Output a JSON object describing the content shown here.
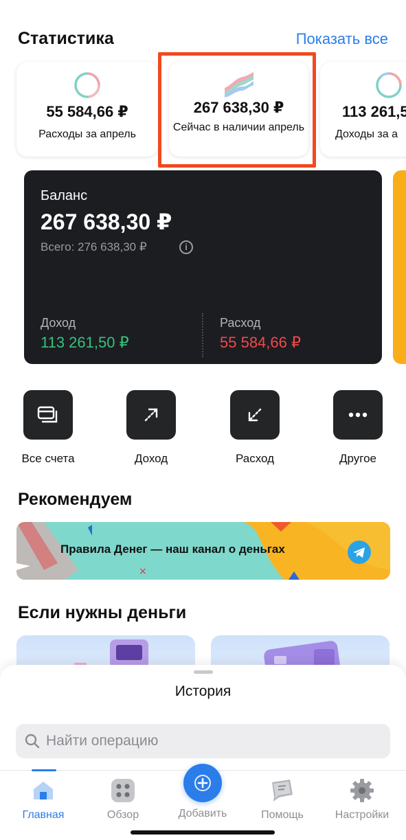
{
  "stats": {
    "title": "Статистика",
    "show_all": "Показать все",
    "cards": [
      {
        "amount": "55 584,66 ₽",
        "label": "Расходы за апрель"
      },
      {
        "amount": "267 638,30 ₽",
        "label": "Сейчас в наличии апрель"
      },
      {
        "amount": "113 261,5",
        "label": "Доходы за а"
      }
    ],
    "highlight_color": "#f2491f"
  },
  "balance": {
    "title": "Баланс",
    "amount": "267 638,30 ₽",
    "total": "Всего: 276 638,30 ₽",
    "info_icon": "i",
    "income_label": "Доход",
    "income_value": "113 261,50 ₽",
    "expense_label": "Расход",
    "expense_value": "55 584,66 ₽",
    "income_color": "#36c27e",
    "expense_color": "#f04a4a"
  },
  "actions": [
    {
      "label": "Все счета",
      "icon": "wallet-cards-icon"
    },
    {
      "label": "Доход",
      "icon": "arrow-up-right-icon"
    },
    {
      "label": "Расход",
      "icon": "arrow-down-left-icon"
    },
    {
      "label": "Другое",
      "icon": "more-dots-icon"
    }
  ],
  "recommend": {
    "title": "Рекомендуем",
    "banner_text": "Правила Денег — наш канал о деньгах",
    "banner_icon": "telegram-icon"
  },
  "money": {
    "title": "Если нужны деньги"
  },
  "history": {
    "title": "История",
    "search_placeholder": "Найти операцию"
  },
  "tabs": [
    {
      "label": "Главная",
      "icon": "home-icon",
      "active": true
    },
    {
      "label": "Обзор",
      "icon": "grid-icon",
      "active": false
    },
    {
      "label": "Добавить",
      "icon": "plus-icon",
      "active": false
    },
    {
      "label": "Помощь",
      "icon": "chat-help-icon",
      "active": false
    },
    {
      "label": "Настройки",
      "icon": "gear-icon",
      "active": false
    }
  ],
  "accent_color": "#2b7de9"
}
